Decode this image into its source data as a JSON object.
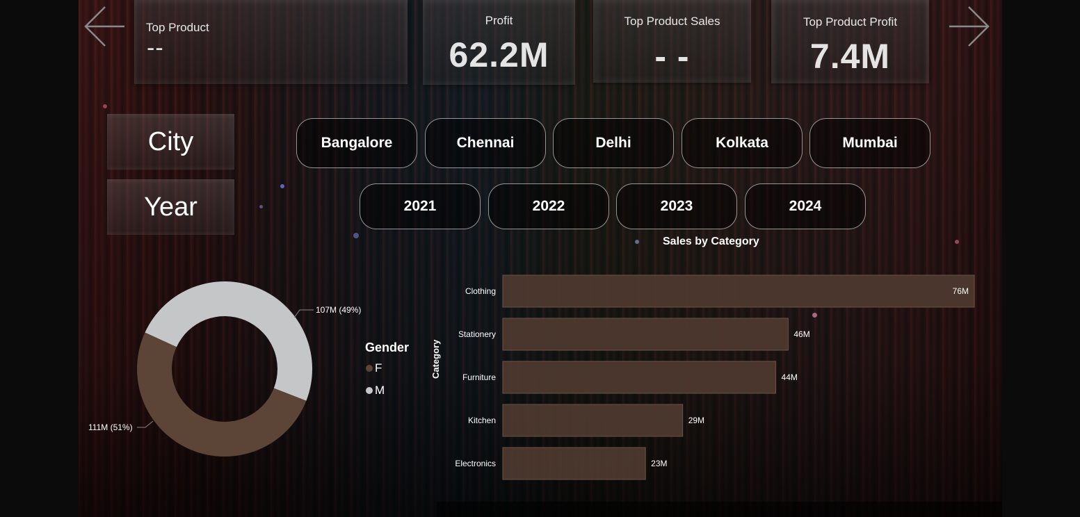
{
  "kpis": {
    "top_product": {
      "title": "Top Product",
      "value": "--"
    },
    "profit": {
      "title": "Profit",
      "value": "62.2M"
    },
    "top_product_sales": {
      "title": "Top Product Sales",
      "value": "- -"
    },
    "top_product_profit": {
      "title": "Top Product Profit",
      "value": "7.4M"
    }
  },
  "icons": {
    "back": "arrow-left-icon",
    "forward": "arrow-right-icon"
  },
  "filters": {
    "city_label": "City",
    "year_label": "Year",
    "cities": [
      "Bangalore",
      "Chennai",
      "Delhi",
      "Kolkata",
      "Mumbai"
    ],
    "years": [
      "2021",
      "2022",
      "2023",
      "2024"
    ]
  },
  "colors": {
    "female": "#5c4437",
    "male": "#c4c6c8",
    "bar": "#4e3a30",
    "bar_border": "#6a5244"
  },
  "gender_donut": {
    "legend_title": "Gender",
    "slices": [
      {
        "label": "F",
        "value": 111,
        "percent": 51,
        "data_label": "111M (51%)"
      },
      {
        "label": "M",
        "value": 107,
        "percent": 49,
        "data_label": "107M (49%)"
      }
    ]
  },
  "chart_data": {
    "type": "bar",
    "orientation": "horizontal",
    "title": "Sales by Category",
    "ylabel": "Category",
    "categories": [
      "Clothing",
      "Stationery",
      "Furniture",
      "Kitchen",
      "Electronics"
    ],
    "values": [
      76,
      46,
      44,
      29,
      23
    ],
    "data_labels": [
      "76M",
      "46M",
      "44M",
      "29M",
      "23M"
    ],
    "xlim": [
      0,
      76
    ]
  }
}
